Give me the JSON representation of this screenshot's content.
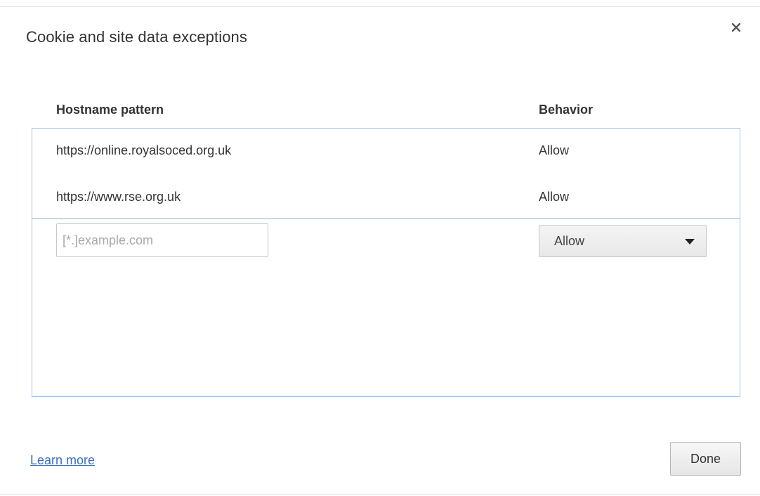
{
  "dialog": {
    "title": "Cookie and site data exceptions",
    "close_icon": "close-icon"
  },
  "table": {
    "headers": {
      "hostname": "Hostname pattern",
      "behavior": "Behavior"
    },
    "rows": [
      {
        "hostname": "https://online.royalsoced.org.uk",
        "behavior": "Allow"
      },
      {
        "hostname": "https://www.rse.org.uk",
        "behavior": "Allow"
      }
    ],
    "new_entry": {
      "placeholder": "[*.]example.com",
      "value": "",
      "behavior_selected": "Allow"
    }
  },
  "footer": {
    "learn_more": "Learn more",
    "done": "Done"
  },
  "colors": {
    "list_border": "#a0c4ec",
    "link": "#3a6fbf"
  }
}
